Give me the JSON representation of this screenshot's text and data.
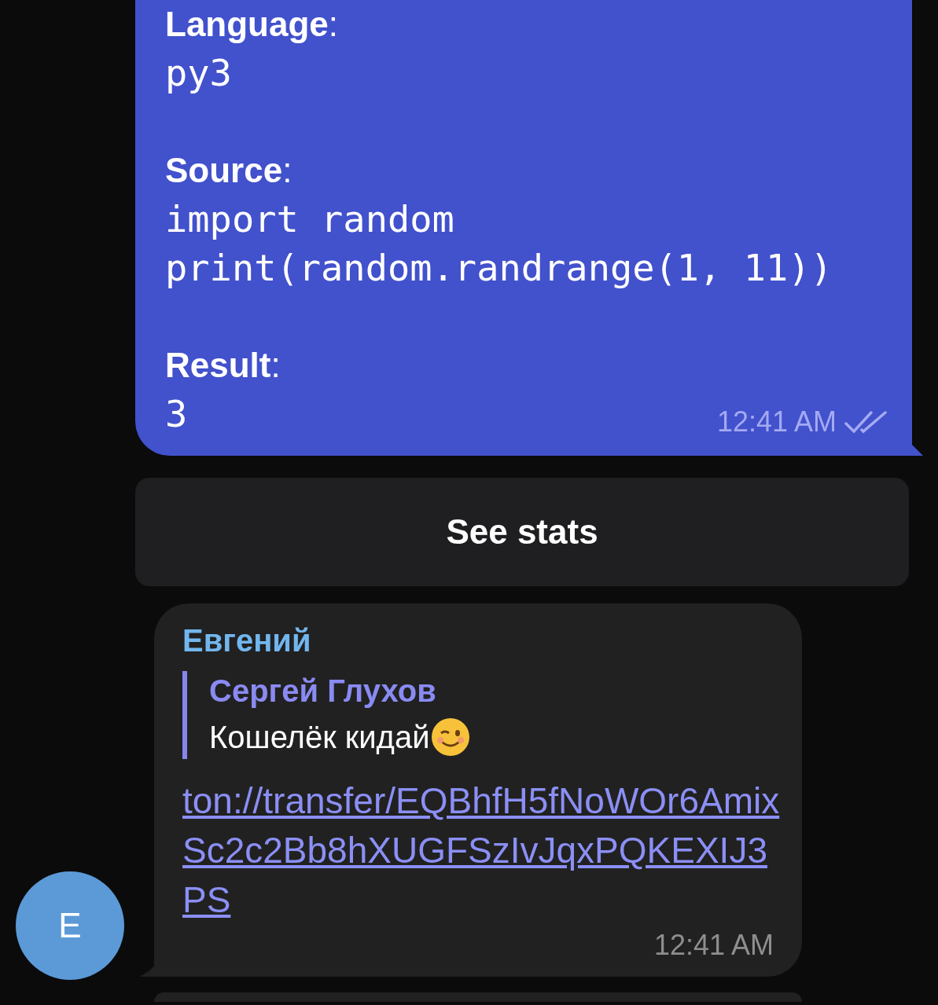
{
  "outgoing": {
    "fields": [
      {
        "label": "**Language**:",
        "lines": [
          "py3"
        ]
      },
      {
        "label": "**Source**:",
        "lines": [
          "import random",
          "print(random.randrange(1, 11))"
        ]
      },
      {
        "label": "**Result**:",
        "lines": [
          "3"
        ]
      }
    ],
    "time": "12:41 AM",
    "read": true
  },
  "inline_button": "See stats",
  "incoming": {
    "sender": "Евгений",
    "reply": {
      "author": "Сергей Глухов",
      "text": "Кошелёк кидай"
    },
    "link": "ton://transfer/EQBhfH5fNoWOr6AmixSc2c2Bb8hXUGFSzIvJqxPQKEXIJ3PS",
    "time": "12:41 AM",
    "avatar": "E"
  }
}
